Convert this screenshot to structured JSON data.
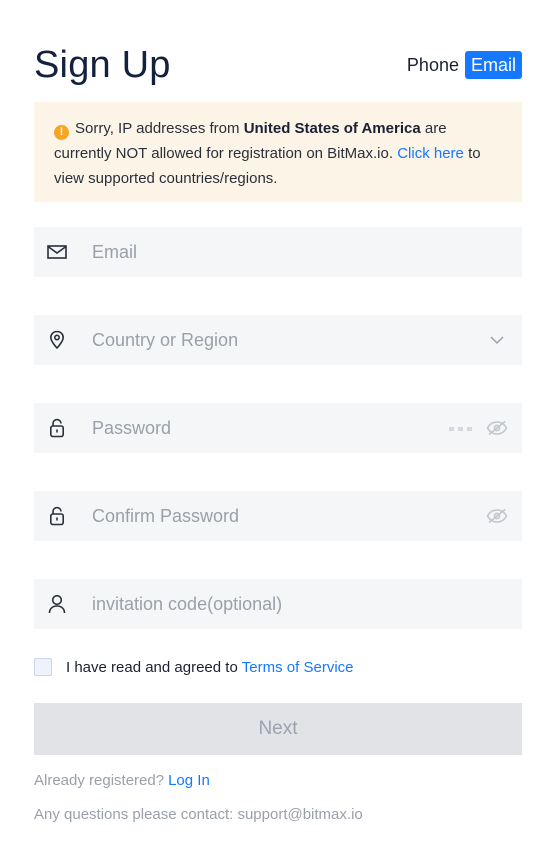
{
  "header": {
    "title": "Sign Up",
    "tabs": [
      {
        "label": "Phone",
        "active": false
      },
      {
        "label": "Email",
        "active": true
      }
    ]
  },
  "notice": {
    "prefix": "Sorry, IP addresses from",
    "country": "United States of America",
    "middle": "are currently NOT allowed for registration on BitMax.io.",
    "link": "Click here",
    "suffix": "to view supported countries/regions."
  },
  "form": {
    "email": {
      "placeholder": "Email",
      "icon": "mail-icon"
    },
    "country": {
      "placeholder": "Country or Region",
      "icon": "location-pin-icon"
    },
    "password": {
      "placeholder": "Password",
      "icon": "lock-icon"
    },
    "confirm_password": {
      "placeholder": "Confirm Password",
      "icon": "lock-icon"
    },
    "invitation": {
      "placeholder": "invitation code(optional)",
      "icon": "user-icon"
    }
  },
  "agree": {
    "text": "I have read and agreed to",
    "link": "Terms of Service",
    "checked": false
  },
  "next_button": {
    "label": "Next"
  },
  "footer": {
    "registered_text": "Already registered?",
    "login_link": "Log In",
    "contact_text": "Any questions please contact: support@bitmax.io"
  },
  "colors": {
    "accent": "#1677ff",
    "warning": "#f5a623",
    "notice_bg": "#fdf4e8",
    "field_bg": "#f5f6f8"
  }
}
